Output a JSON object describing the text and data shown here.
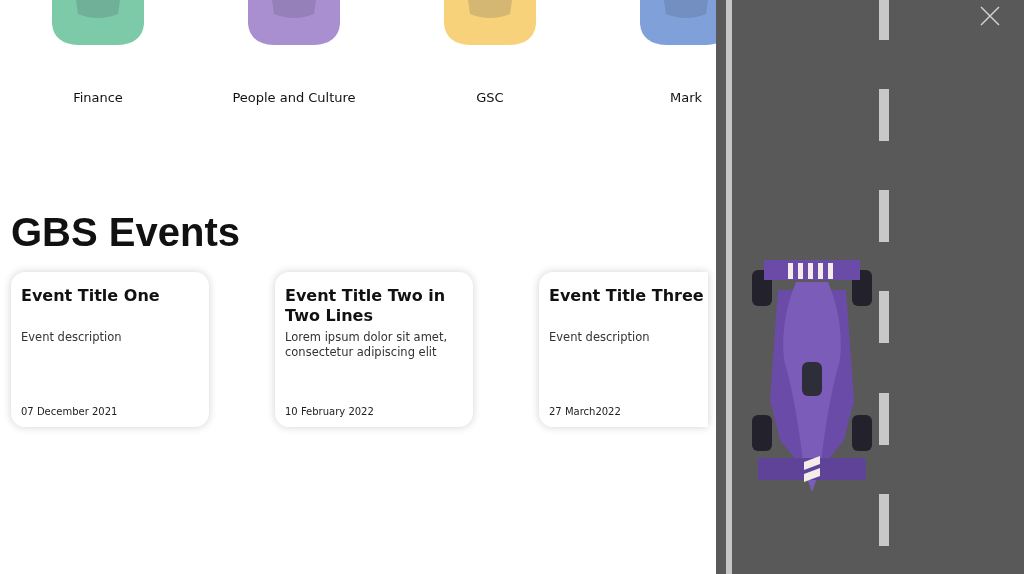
{
  "departments": [
    {
      "label": "Finance",
      "color": "#7ccaa8"
    },
    {
      "label": "People and Culture",
      "color": "#a98fd0"
    },
    {
      "label": "GSC",
      "color": "#f7d27a"
    },
    {
      "label": "Mark",
      "color": "#7fa0d8"
    }
  ],
  "events_section": {
    "heading": "GBS Events",
    "events": [
      {
        "title": "Event Title One",
        "description": "Event description",
        "date": "07 December 2021"
      },
      {
        "title": "Event Title Two in Two Lines",
        "description": "Lorem ipsum dolor sit amet, consectetur adipiscing elit",
        "date": "10 February 2022"
      },
      {
        "title": "Event Title Three",
        "description": "Event description",
        "date": "27 March2022"
      }
    ]
  }
}
